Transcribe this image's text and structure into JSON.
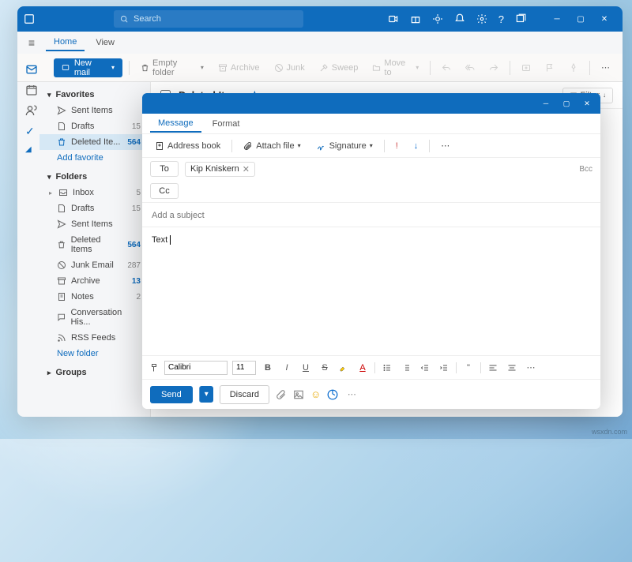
{
  "titlebar": {
    "search_placeholder": "Search"
  },
  "tabs": {
    "home": "Home",
    "view": "View"
  },
  "toolbar": {
    "new_mail": "New mail",
    "empty_folder": "Empty folder",
    "archive": "Archive",
    "junk": "Junk",
    "sweep": "Sweep",
    "move_to": "Move to"
  },
  "sidebar": {
    "favorites": "Favorites",
    "folders": "Folders",
    "groups": "Groups",
    "add_favorite": "Add favorite",
    "new_folder": "New folder",
    "fav_items": [
      {
        "icon": "sent",
        "label": "Sent Items",
        "count": ""
      },
      {
        "icon": "draft",
        "label": "Drafts",
        "count": "15"
      },
      {
        "icon": "trash",
        "label": "Deleted Ite...",
        "count": "564"
      }
    ],
    "folder_items": [
      {
        "icon": "inbox",
        "label": "Inbox",
        "count": "5"
      },
      {
        "icon": "draft",
        "label": "Drafts",
        "count": "15"
      },
      {
        "icon": "sent",
        "label": "Sent Items",
        "count": ""
      },
      {
        "icon": "trash",
        "label": "Deleted Items",
        "count": "564"
      },
      {
        "icon": "junk",
        "label": "Junk Email",
        "count": "287"
      },
      {
        "icon": "archive",
        "label": "Archive",
        "count": "13"
      },
      {
        "icon": "notes",
        "label": "Notes",
        "count": "2"
      },
      {
        "icon": "convo",
        "label": "Conversation His...",
        "count": ""
      },
      {
        "icon": "rss",
        "label": "RSS Feeds",
        "count": ""
      }
    ]
  },
  "content": {
    "title": "Deleted Items",
    "filter": "Filter"
  },
  "compose": {
    "tabs": {
      "message": "Message",
      "format": "Format"
    },
    "toolbar": {
      "address_book": "Address book",
      "attach_file": "Attach file",
      "signature": "Signature"
    },
    "to_label": "To",
    "cc_label": "Cc",
    "bcc_label": "Bcc",
    "recipient": "Kip Kniskern",
    "subject_placeholder": "Add a subject",
    "body_text": "Text",
    "font": "Calibri",
    "size": "11",
    "send": "Send",
    "discard": "Discard"
  },
  "watermark": "wsxdn.com"
}
